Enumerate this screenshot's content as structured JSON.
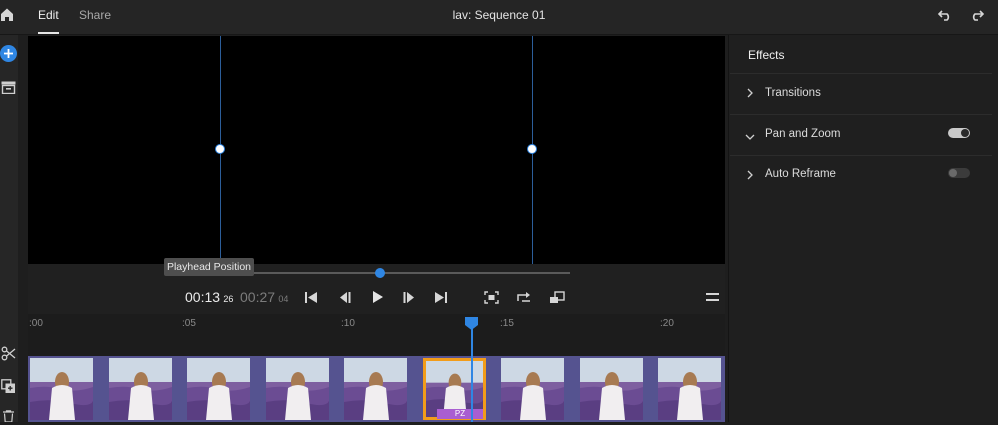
{
  "header": {
    "tabs": [
      {
        "label": "Edit",
        "active": true
      },
      {
        "label": "Share",
        "active": false
      }
    ],
    "title": "lav: Sequence 01",
    "icons": [
      "home-icon",
      "undo-icon",
      "redo-icon"
    ]
  },
  "sidebar": {
    "icons": [
      "add-icon",
      "media-bin-icon",
      "scissors-icon",
      "duplicate-icon",
      "trash-icon"
    ]
  },
  "player": {
    "tooltip": "Playhead Position",
    "current_time": "00:13",
    "current_frames": "26",
    "duration_time": "00:27",
    "duration_frames": "04",
    "scrub_progress": 0.45
  },
  "timeline": {
    "ticks": [
      ":00",
      ":05",
      ":10",
      ":15",
      ":20"
    ],
    "clip_count": 9,
    "selected_clip_index": 5,
    "selected_clip_badge": "PZ"
  },
  "effects_panel": {
    "title": "Effects",
    "rows": [
      {
        "label": "Transitions",
        "state": "collapsed",
        "has_toggle": false
      },
      {
        "label": "Pan and Zoom",
        "state": "expanded",
        "has_toggle": true,
        "toggle_on": true
      },
      {
        "label": "Auto Reframe",
        "state": "collapsed",
        "has_toggle": true,
        "toggle_on": false
      }
    ]
  },
  "colors": {
    "accent": "#2f86e3",
    "selection": "#f29c1a",
    "clip_track": "#555390",
    "pz_badge": "#a95ed1"
  }
}
